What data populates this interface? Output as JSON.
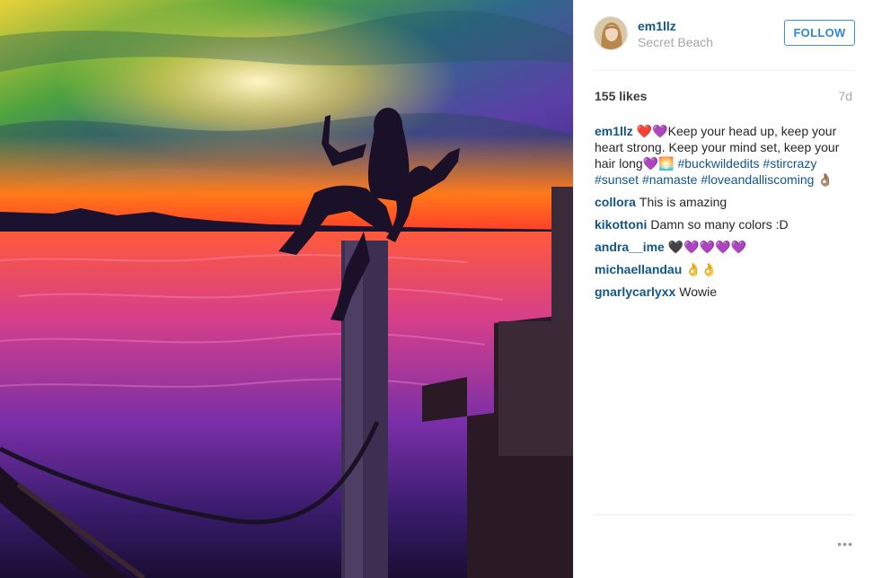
{
  "post": {
    "username": "em1llz",
    "location": "Secret Beach",
    "follow_label": "FOLLOW",
    "likes": "155 likes",
    "age": "7d",
    "caption": {
      "user": "em1llz",
      "text": "❤️💜Keep your head up, keep your heart strong. Keep your mind set, keep your hair long💜🌅",
      "hashtags": [
        "#buckwildedits",
        "#stircrazy",
        "#sunset",
        "#namaste",
        "#loveandalliscoming"
      ],
      "trail": "👌🏽"
    },
    "comments": [
      {
        "user": "collora",
        "text": "This is amazing"
      },
      {
        "user": "kikottoni",
        "text": "Damn so many colors :D"
      },
      {
        "user": "andra__ime",
        "text": "🖤💜💜💜💜"
      },
      {
        "user": "michaellandau",
        "text": "👌👌"
      },
      {
        "user": "gnarlycarlyxx",
        "text": "Wowie"
      }
    ],
    "more_label": "•••"
  }
}
